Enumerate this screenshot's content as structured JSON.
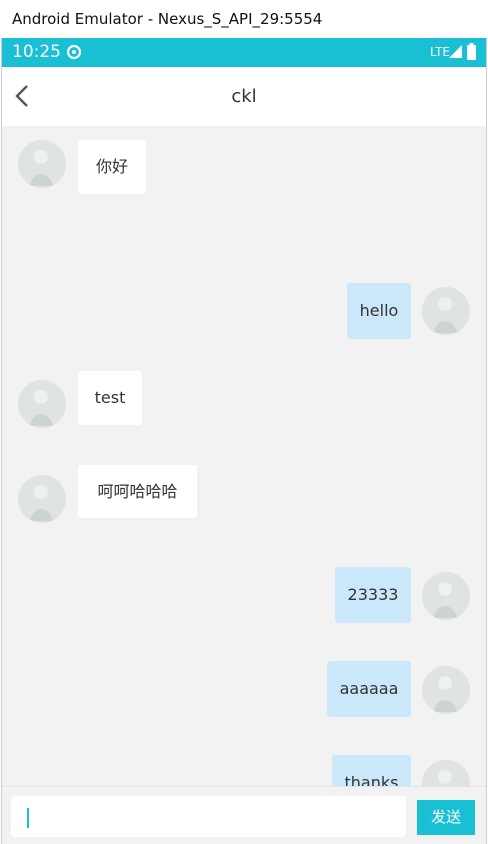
{
  "window": {
    "title": "Android Emulator - Nexus_S_API_29:5554"
  },
  "status_bar": {
    "time": "10:25",
    "network": "LTE",
    "accent_color": "#19bfd3"
  },
  "app_bar": {
    "title": "ckl",
    "back_icon": "back-arrow-icon"
  },
  "messages": [
    {
      "side": "left",
      "text": "你好"
    },
    {
      "side": "right",
      "text": "hello"
    },
    {
      "side": "left",
      "text": "test"
    },
    {
      "side": "left",
      "text": "呵呵哈哈哈"
    },
    {
      "side": "right",
      "text": "23333"
    },
    {
      "side": "right",
      "text": "aaaaaa"
    },
    {
      "side": "right",
      "text": "thanks"
    }
  ],
  "input": {
    "value": "",
    "send_label": "发送"
  },
  "colors": {
    "background": "#f2f2f2",
    "outgoing_bubble": "#cbe8fb",
    "incoming_bubble": "#ffffff"
  }
}
